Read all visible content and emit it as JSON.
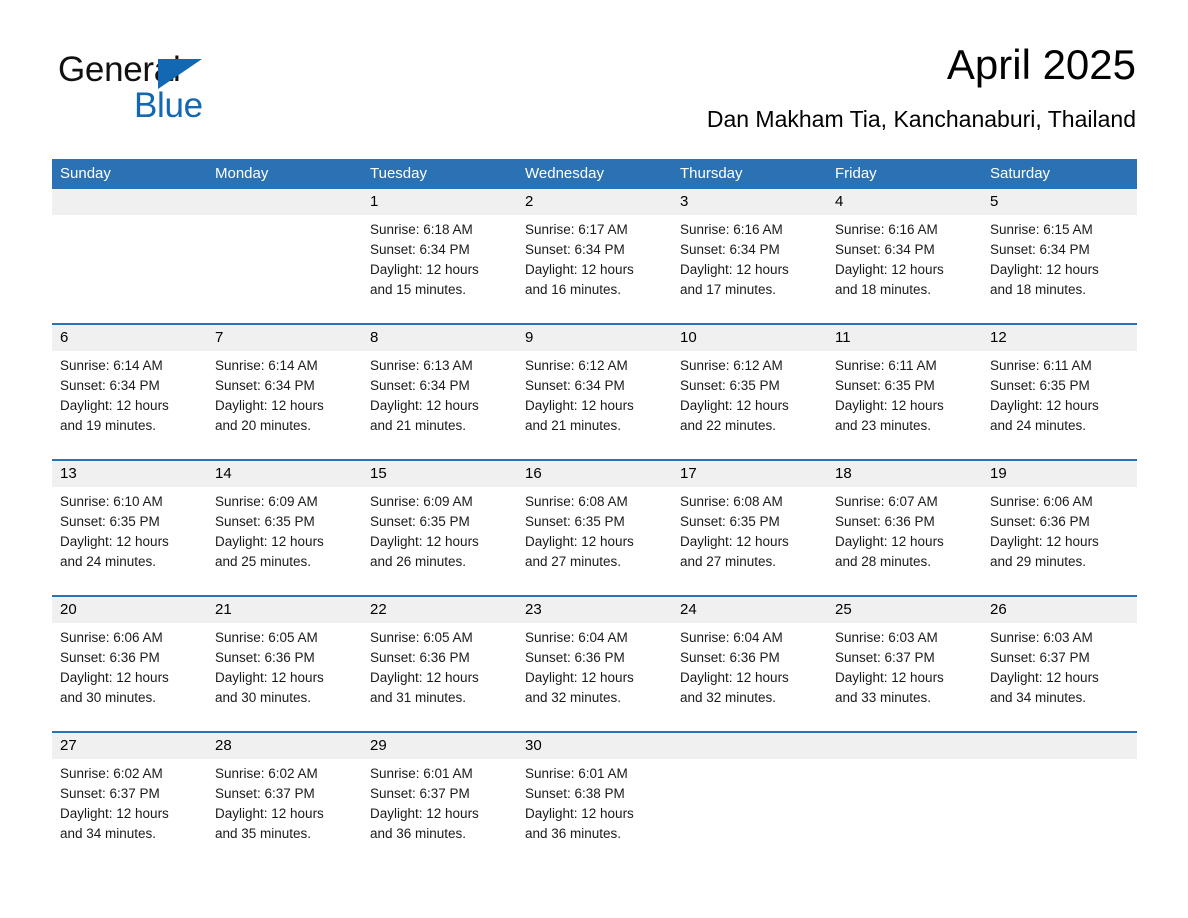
{
  "brand": {
    "name_part1": "General",
    "name_part2": "Blue",
    "accent_color": "#1268b3"
  },
  "header": {
    "month_title": "April 2025",
    "location": "Dan Makham Tia, Kanchanaburi, Thailand"
  },
  "calendar": {
    "header_color": "#2b72b5",
    "daynum_band_color": "#f0f0f0",
    "weekdays": [
      "Sunday",
      "Monday",
      "Tuesday",
      "Wednesday",
      "Thursday",
      "Friday",
      "Saturday"
    ],
    "weeks": [
      [
        {
          "day": "",
          "lines": []
        },
        {
          "day": "",
          "lines": []
        },
        {
          "day": "1",
          "lines": [
            "Sunrise: 6:18 AM",
            "Sunset: 6:34 PM",
            "Daylight: 12 hours",
            "and 15 minutes."
          ]
        },
        {
          "day": "2",
          "lines": [
            "Sunrise: 6:17 AM",
            "Sunset: 6:34 PM",
            "Daylight: 12 hours",
            "and 16 minutes."
          ]
        },
        {
          "day": "3",
          "lines": [
            "Sunrise: 6:16 AM",
            "Sunset: 6:34 PM",
            "Daylight: 12 hours",
            "and 17 minutes."
          ]
        },
        {
          "day": "4",
          "lines": [
            "Sunrise: 6:16 AM",
            "Sunset: 6:34 PM",
            "Daylight: 12 hours",
            "and 18 minutes."
          ]
        },
        {
          "day": "5",
          "lines": [
            "Sunrise: 6:15 AM",
            "Sunset: 6:34 PM",
            "Daylight: 12 hours",
            "and 18 minutes."
          ]
        }
      ],
      [
        {
          "day": "6",
          "lines": [
            "Sunrise: 6:14 AM",
            "Sunset: 6:34 PM",
            "Daylight: 12 hours",
            "and 19 minutes."
          ]
        },
        {
          "day": "7",
          "lines": [
            "Sunrise: 6:14 AM",
            "Sunset: 6:34 PM",
            "Daylight: 12 hours",
            "and 20 minutes."
          ]
        },
        {
          "day": "8",
          "lines": [
            "Sunrise: 6:13 AM",
            "Sunset: 6:34 PM",
            "Daylight: 12 hours",
            "and 21 minutes."
          ]
        },
        {
          "day": "9",
          "lines": [
            "Sunrise: 6:12 AM",
            "Sunset: 6:34 PM",
            "Daylight: 12 hours",
            "and 21 minutes."
          ]
        },
        {
          "day": "10",
          "lines": [
            "Sunrise: 6:12 AM",
            "Sunset: 6:35 PM",
            "Daylight: 12 hours",
            "and 22 minutes."
          ]
        },
        {
          "day": "11",
          "lines": [
            "Sunrise: 6:11 AM",
            "Sunset: 6:35 PM",
            "Daylight: 12 hours",
            "and 23 minutes."
          ]
        },
        {
          "day": "12",
          "lines": [
            "Sunrise: 6:11 AM",
            "Sunset: 6:35 PM",
            "Daylight: 12 hours",
            "and 24 minutes."
          ]
        }
      ],
      [
        {
          "day": "13",
          "lines": [
            "Sunrise: 6:10 AM",
            "Sunset: 6:35 PM",
            "Daylight: 12 hours",
            "and 24 minutes."
          ]
        },
        {
          "day": "14",
          "lines": [
            "Sunrise: 6:09 AM",
            "Sunset: 6:35 PM",
            "Daylight: 12 hours",
            "and 25 minutes."
          ]
        },
        {
          "day": "15",
          "lines": [
            "Sunrise: 6:09 AM",
            "Sunset: 6:35 PM",
            "Daylight: 12 hours",
            "and 26 minutes."
          ]
        },
        {
          "day": "16",
          "lines": [
            "Sunrise: 6:08 AM",
            "Sunset: 6:35 PM",
            "Daylight: 12 hours",
            "and 27 minutes."
          ]
        },
        {
          "day": "17",
          "lines": [
            "Sunrise: 6:08 AM",
            "Sunset: 6:35 PM",
            "Daylight: 12 hours",
            "and 27 minutes."
          ]
        },
        {
          "day": "18",
          "lines": [
            "Sunrise: 6:07 AM",
            "Sunset: 6:36 PM",
            "Daylight: 12 hours",
            "and 28 minutes."
          ]
        },
        {
          "day": "19",
          "lines": [
            "Sunrise: 6:06 AM",
            "Sunset: 6:36 PM",
            "Daylight: 12 hours",
            "and 29 minutes."
          ]
        }
      ],
      [
        {
          "day": "20",
          "lines": [
            "Sunrise: 6:06 AM",
            "Sunset: 6:36 PM",
            "Daylight: 12 hours",
            "and 30 minutes."
          ]
        },
        {
          "day": "21",
          "lines": [
            "Sunrise: 6:05 AM",
            "Sunset: 6:36 PM",
            "Daylight: 12 hours",
            "and 30 minutes."
          ]
        },
        {
          "day": "22",
          "lines": [
            "Sunrise: 6:05 AM",
            "Sunset: 6:36 PM",
            "Daylight: 12 hours",
            "and 31 minutes."
          ]
        },
        {
          "day": "23",
          "lines": [
            "Sunrise: 6:04 AM",
            "Sunset: 6:36 PM",
            "Daylight: 12 hours",
            "and 32 minutes."
          ]
        },
        {
          "day": "24",
          "lines": [
            "Sunrise: 6:04 AM",
            "Sunset: 6:36 PM",
            "Daylight: 12 hours",
            "and 32 minutes."
          ]
        },
        {
          "day": "25",
          "lines": [
            "Sunrise: 6:03 AM",
            "Sunset: 6:37 PM",
            "Daylight: 12 hours",
            "and 33 minutes."
          ]
        },
        {
          "day": "26",
          "lines": [
            "Sunrise: 6:03 AM",
            "Sunset: 6:37 PM",
            "Daylight: 12 hours",
            "and 34 minutes."
          ]
        }
      ],
      [
        {
          "day": "27",
          "lines": [
            "Sunrise: 6:02 AM",
            "Sunset: 6:37 PM",
            "Daylight: 12 hours",
            "and 34 minutes."
          ]
        },
        {
          "day": "28",
          "lines": [
            "Sunrise: 6:02 AM",
            "Sunset: 6:37 PM",
            "Daylight: 12 hours",
            "and 35 minutes."
          ]
        },
        {
          "day": "29",
          "lines": [
            "Sunrise: 6:01 AM",
            "Sunset: 6:37 PM",
            "Daylight: 12 hours",
            "and 36 minutes."
          ]
        },
        {
          "day": "30",
          "lines": [
            "Sunrise: 6:01 AM",
            "Sunset: 6:38 PM",
            "Daylight: 12 hours",
            "and 36 minutes."
          ]
        },
        {
          "day": "",
          "lines": []
        },
        {
          "day": "",
          "lines": []
        },
        {
          "day": "",
          "lines": []
        }
      ]
    ]
  }
}
